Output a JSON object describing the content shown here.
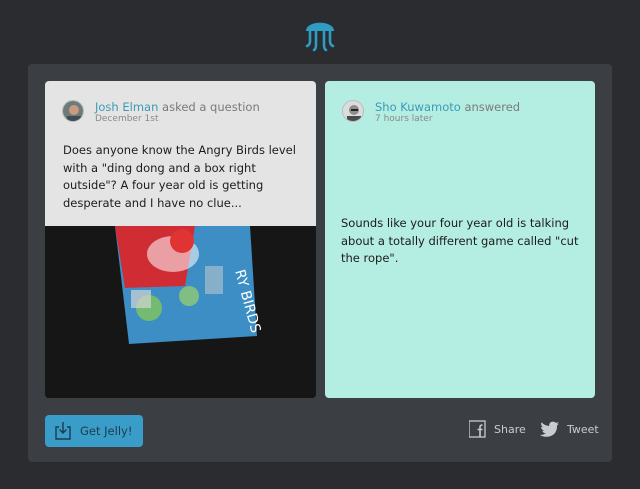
{
  "question": {
    "author": "Josh Elman",
    "action": "asked a question",
    "time": "December 1st",
    "text": "Does anyone know the Angry Birds level with a \"ding dong and a box right outside\"? A four year old is getting desperate and I have no clue..."
  },
  "answer": {
    "author": "Sho Kuwamoto",
    "action": "answered",
    "time": "7 hours later",
    "text": "Sounds like your four year old is talking about a totally different game called \"cut the rope\"."
  },
  "footer": {
    "get_label": "Get Jelly!",
    "share_label": "Share",
    "tweet_label": "Tweet"
  },
  "icons": {
    "logo": "jellyfish-icon",
    "get": "download-box-icon",
    "share": "facebook-icon",
    "tweet": "twitter-bird-icon"
  },
  "colors": {
    "background": "#2a2c2f",
    "panel": "#3b3f44",
    "accent": "#3a9cc9",
    "name": "#3c9bb5",
    "answer_card": "#b4ede1",
    "question_card": "#e4e4e4"
  }
}
